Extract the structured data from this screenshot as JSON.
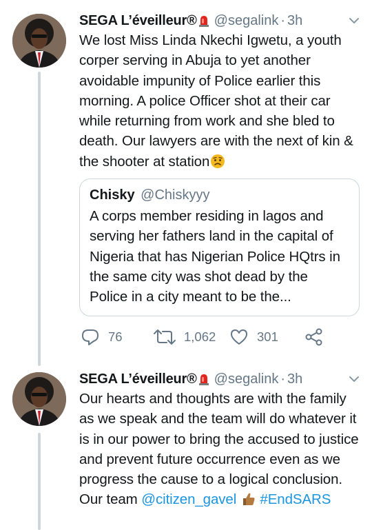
{
  "tweets": [
    {
      "display_name": "SEGA L’éveilleur®",
      "handle": "@segalink",
      "separator": "·",
      "time": "3h",
      "text": "We lost Miss Linda Nkechi Igwetu, a youth corper serving in Abuja to yet another avoidable impunity of Police earlier this morning. A police Officer shot at their car while returning from work and she bled to death. Our lawyers are with the next of kin & the shooter at station",
      "trailing_emoji": "worried-face-emoji",
      "quoted_tweet": {
        "display_name": "Chisky",
        "handle": "@Chiskyyy",
        "text": "A corps member residing in lagos and serving her fathers land in the capital of Nigeria that has Nigerian Police HQtrs in the same city was shot dead by the Police in a city meant to be the..."
      },
      "stats": {
        "replies": "76",
        "retweets": "1,062",
        "likes": "301"
      }
    },
    {
      "display_name": "SEGA L’éveilleur®",
      "handle": "@segalink",
      "separator": "·",
      "time": "3h",
      "text": "Our hearts and thoughts are with the family as we speak and the team will do whatever it is in our power to bring the accused to justice and prevent future occurrence even as we progress the cause to a logical conclusion. Our team",
      "mention": "@citizen_gavel",
      "hashtag": "#EndSARS"
    }
  ],
  "colors": {
    "text": "#14171a",
    "secondary": "#657786",
    "link": "#1b95e0",
    "thread_line": "#cdd6dd",
    "border": "#ccd6dd",
    "siren": "#e0261f"
  },
  "icons": [
    "siren-emoji",
    "chevron-down-icon",
    "reply-icon",
    "retweet-icon",
    "like-icon",
    "share-icon",
    "worried-face-emoji",
    "thumbs-up-emoji"
  ]
}
